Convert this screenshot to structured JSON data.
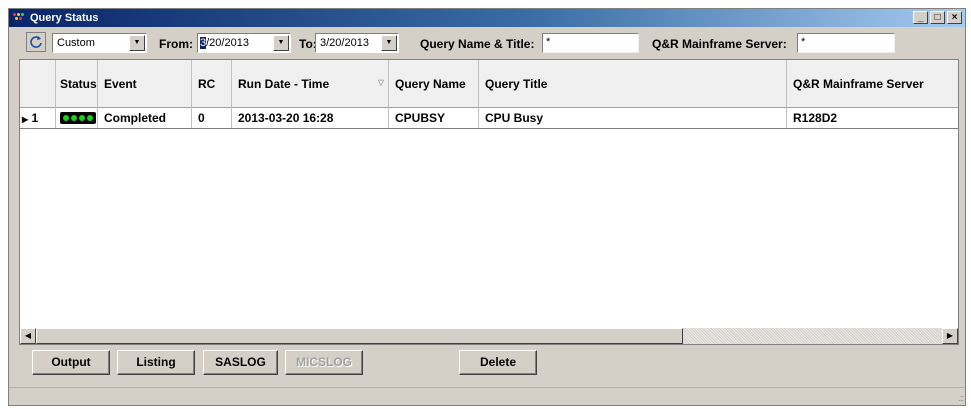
{
  "window": {
    "title": "Query Status",
    "controls": [
      "_",
      "□",
      "×"
    ]
  },
  "toolbar": {
    "refresh_icon": "refresh-icon",
    "range_select": "Custom",
    "from_label": "From:",
    "from_date_selected": "3",
    "from_date_rest": "/20/2013",
    "to_label": "To:",
    "to_date": "3/20/2013",
    "query_name_label": "Query Name & Title:",
    "query_name_value": "*",
    "server_label": "Q&R Mainframe Server:",
    "server_value": "*"
  },
  "grid": {
    "columns": [
      {
        "key": "row",
        "label": ""
      },
      {
        "key": "status",
        "label": "Status"
      },
      {
        "key": "event",
        "label": "Event"
      },
      {
        "key": "rc",
        "label": "RC"
      },
      {
        "key": "run_date",
        "label": "Run Date - Time"
      },
      {
        "key": "query_name",
        "label": "Query Name"
      },
      {
        "key": "query_title",
        "label": "Query Title"
      },
      {
        "key": "server",
        "label": "Q&R Mainframe Server"
      }
    ],
    "rows": [
      {
        "row": "1",
        "status": "completed-indicator",
        "event": "Completed",
        "rc": "0",
        "run_date": "2013-03-20 16:28",
        "query_name": "CPUBSY",
        "query_title": "CPU Busy",
        "server": "R128D2"
      }
    ]
  },
  "buttons": {
    "output": "Output",
    "listing": "Listing",
    "saslog": "SASLOG",
    "micslog": "MICSLOG",
    "delete": "Delete"
  },
  "colors": {
    "titlebar_start": "#0a246a",
    "titlebar_end": "#a6caf0",
    "led_green": "#1ad01a",
    "face": "#d4d0c8"
  }
}
